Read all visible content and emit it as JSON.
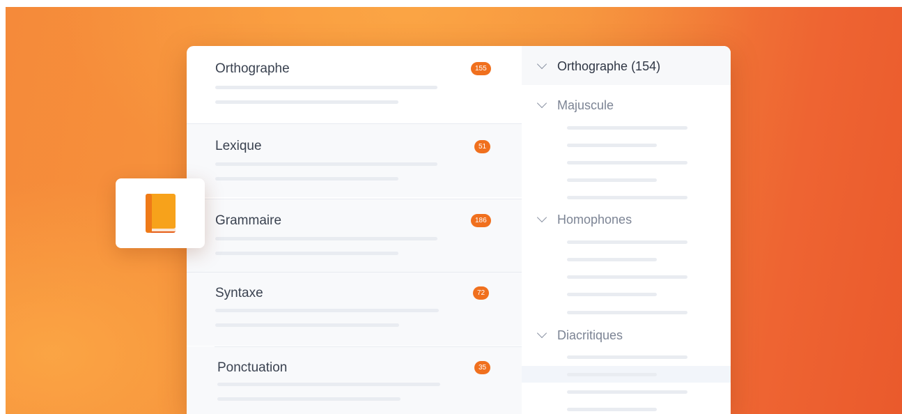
{
  "categories": [
    {
      "label": "Orthographe",
      "count": "155"
    },
    {
      "label": "Lexique",
      "count": "51"
    },
    {
      "label": "Grammaire",
      "count": "186"
    },
    {
      "label": "Syntaxe",
      "count": "72"
    },
    {
      "label": "Ponctuation",
      "count": "35"
    }
  ],
  "tree": {
    "header": "Orthographe (154)",
    "sections": [
      "Majuscule",
      "Homophones",
      "Diacritiques"
    ]
  },
  "icons": {
    "app": "book-icon",
    "expand": "chevron-down-icon"
  },
  "colors": {
    "accent": "#f0701e",
    "book": "#f7a21b"
  }
}
